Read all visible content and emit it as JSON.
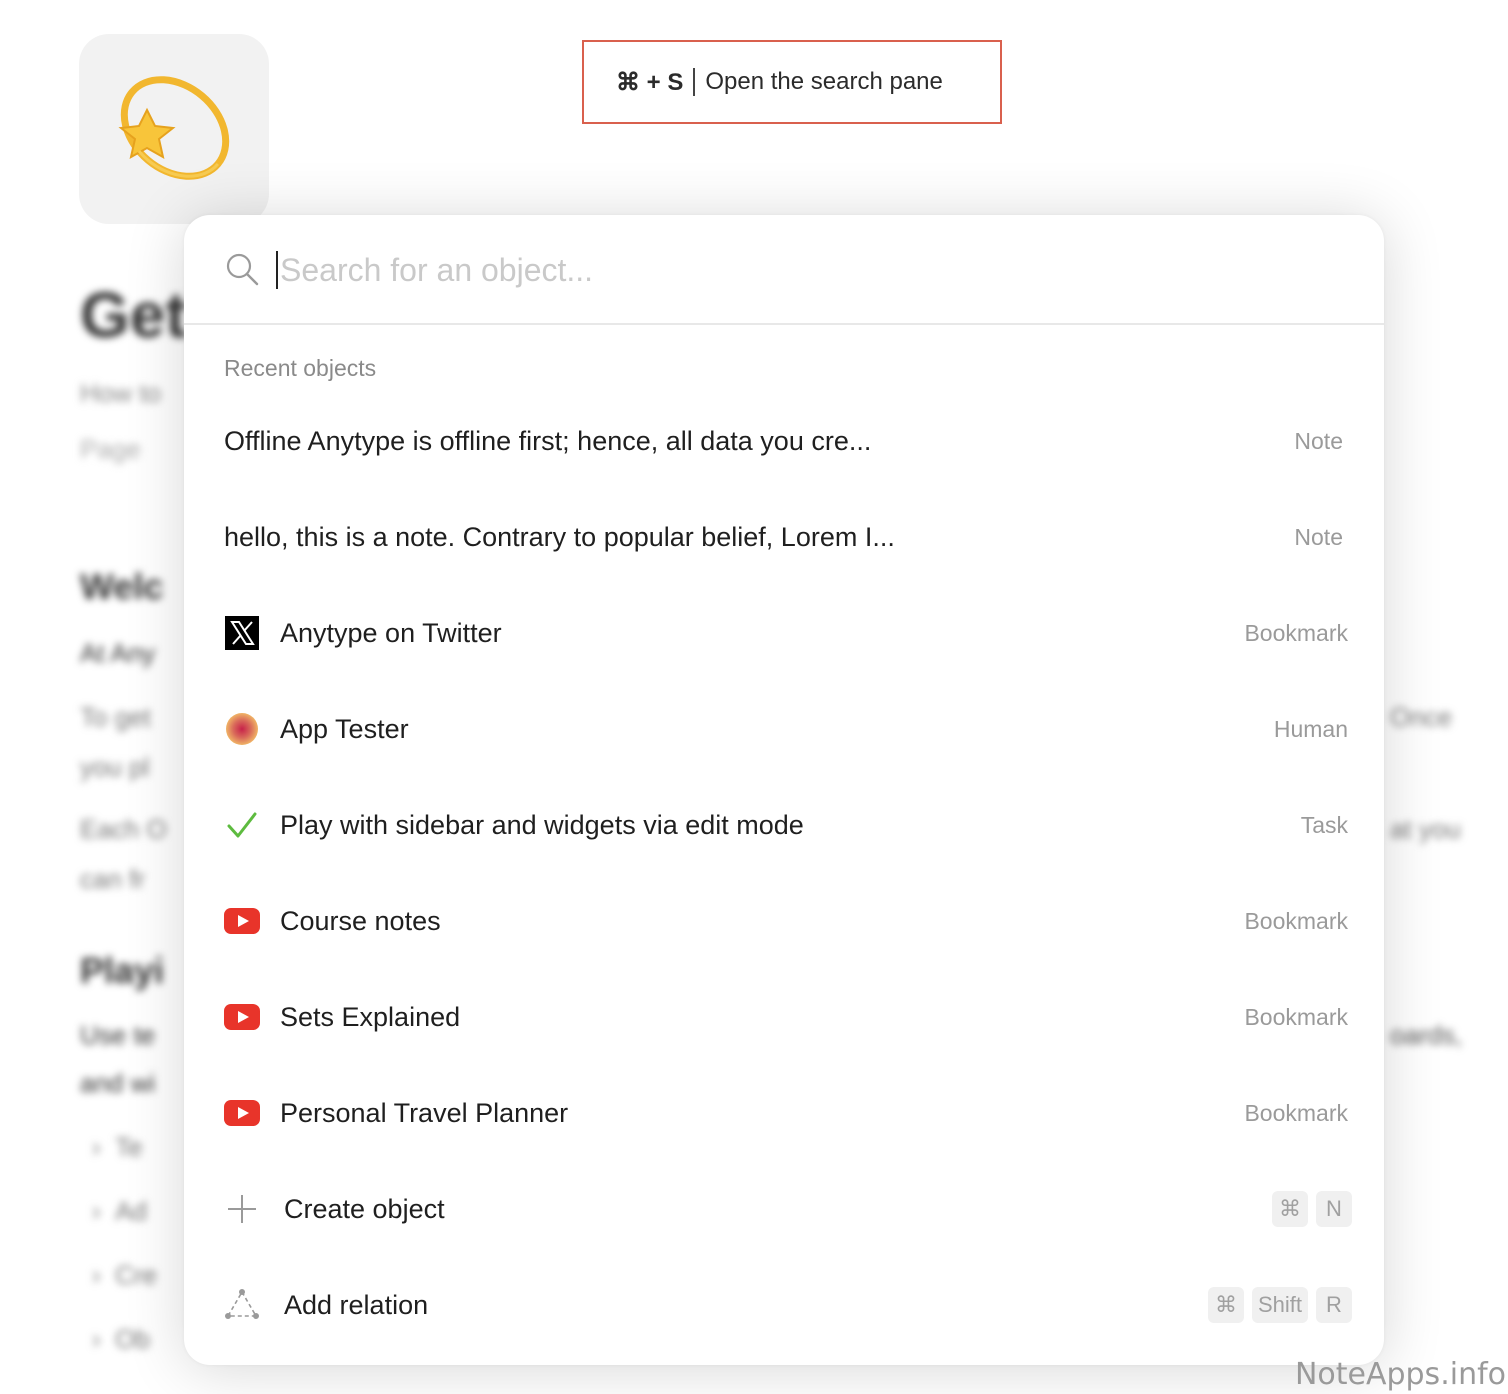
{
  "background": {
    "title": "Get",
    "subtitle": "How to",
    "type_label": "Page",
    "heading_1": "Welc",
    "para_1": "At Any",
    "para_2a": "To get",
    "para_2b": "you pl",
    "para_3a": "Each O",
    "para_3b": "can fr",
    "heading_2": "Playi",
    "para_4a": "Use te",
    "para_4b": "and wi",
    "list_items": [
      "Te",
      "Ad",
      "Cre",
      "Ob"
    ],
    "right_1": "Once",
    "right_2": "at you",
    "right_3": "oards,"
  },
  "hint": {
    "keys": "⌘ + S",
    "text": "Open the search pane"
  },
  "search": {
    "placeholder": "Search for an object...",
    "value": ""
  },
  "recent": {
    "label": "Recent objects",
    "items": [
      {
        "title": "Offline Anytype is offline first; hence, all data you cre...",
        "type": "Note",
        "icon": "none"
      },
      {
        "title": "hello, this is a note. Contrary to popular belief, Lorem I...",
        "type": "Note",
        "icon": "none"
      },
      {
        "title": "Anytype on Twitter",
        "type": "Bookmark",
        "icon": "x-logo-icon"
      },
      {
        "title": "App Tester",
        "type": "Human",
        "icon": "avatar-icon"
      },
      {
        "title": "Play with sidebar and widgets via edit mode",
        "type": "Task",
        "icon": "checkmark-icon"
      },
      {
        "title": "Course notes",
        "type": "Bookmark",
        "icon": "youtube-icon"
      },
      {
        "title": "Sets Explained",
        "type": "Bookmark",
        "icon": "youtube-icon"
      },
      {
        "title": "Personal Travel Planner",
        "type": "Bookmark",
        "icon": "youtube-icon"
      }
    ]
  },
  "actions": {
    "create": {
      "label": "Create object",
      "keys": [
        "⌘",
        "N"
      ]
    },
    "relation": {
      "label": "Add relation",
      "keys": [
        "⌘",
        "Shift",
        "R"
      ]
    }
  },
  "watermark": "NoteApps.info",
  "colors": {
    "hint_border": "#d9604d",
    "youtube_red": "#e8342a",
    "check_green": "#5dbb3f",
    "star_gold": "#f2b72f"
  }
}
